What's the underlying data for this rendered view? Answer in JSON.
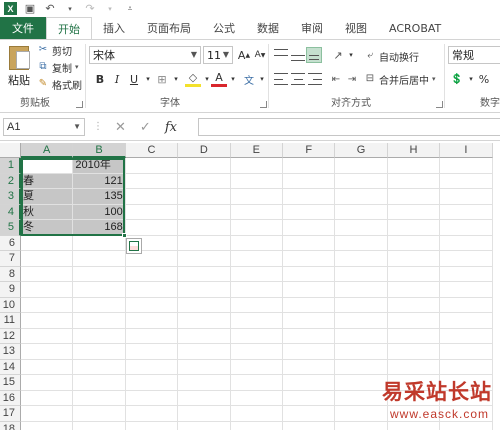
{
  "tabs": {
    "file": "文件",
    "items": [
      "开始",
      "插入",
      "页面布局",
      "公式",
      "数据",
      "审阅",
      "视图",
      "ACROBAT"
    ]
  },
  "ribbon": {
    "clipboard": {
      "paste": "粘贴",
      "cut": "剪切",
      "copy": "复制",
      "format_painter": "格式刷",
      "label": "剪贴板"
    },
    "font": {
      "name": "宋体",
      "size": "11",
      "label": "字体"
    },
    "alignment": {
      "wrap_text": "自动换行",
      "merge_center": "合并后居中",
      "label": "对齐方式"
    },
    "number": {
      "format": "常规",
      "label": "数字"
    }
  },
  "formula_bar": {
    "name_box": "A1",
    "fx": "fx",
    "value": ""
  },
  "sheet": {
    "columns": [
      "A",
      "B",
      "C",
      "D",
      "E",
      "F",
      "G",
      "H",
      "I"
    ],
    "rows": [
      "1",
      "2",
      "3",
      "4",
      "5",
      "6",
      "7",
      "8",
      "9",
      "10",
      "11",
      "12",
      "13",
      "14",
      "15",
      "16",
      "17",
      "18"
    ],
    "data": [
      [
        "",
        "2010年"
      ],
      [
        "春",
        "121"
      ],
      [
        "夏",
        "135"
      ],
      [
        "秋",
        "100"
      ],
      [
        "冬",
        "168"
      ]
    ]
  },
  "watermark": {
    "title": "易采站长站",
    "url": "www.easck.com"
  },
  "colors": {
    "accent": "#217346",
    "selection_fill": "#c6c6c6",
    "watermark": "#c0392b"
  }
}
